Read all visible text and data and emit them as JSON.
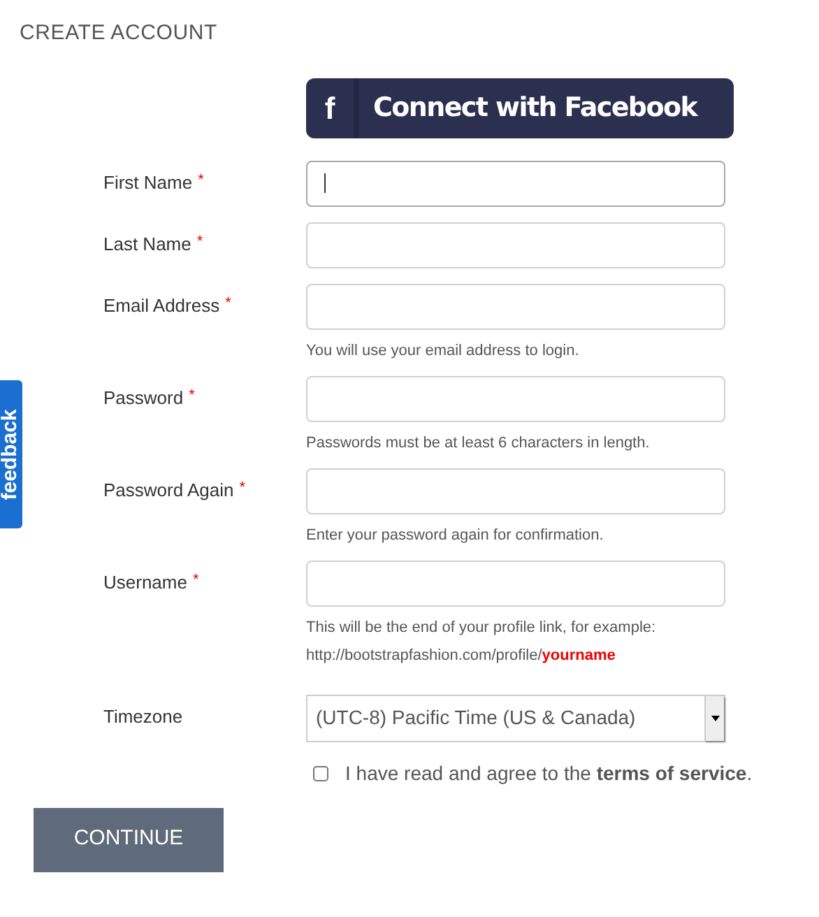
{
  "title": "CREATE ACCOUNT",
  "facebook_button": {
    "icon": "f",
    "label": "Connect with Facebook"
  },
  "feedback_tab": {
    "label": "feedback"
  },
  "fields": [
    {
      "kind": "text",
      "label": "First Name",
      "required": true,
      "focused": true
    },
    {
      "kind": "text",
      "label": "Last Name",
      "required": true,
      "focused": false
    },
    {
      "kind": "text",
      "label": "Email Address",
      "required": true,
      "focused": false,
      "hint": "You will use your email address to login."
    },
    {
      "kind": "text",
      "label": "Password",
      "required": true,
      "focused": false,
      "hint": "Passwords must be at least 6 characters in length."
    },
    {
      "kind": "text",
      "label": "Password Again",
      "required": true,
      "focused": false,
      "hint": "Enter your password again for confirmation."
    },
    {
      "kind": "text",
      "label": "Username",
      "required": true,
      "focused": false,
      "hint": "This will be the end of your profile link, for example:",
      "example": {
        "prefix": "http://bootstrapfashion.com/profile/",
        "highlight": "yourname"
      }
    },
    {
      "kind": "select",
      "label": "Timezone",
      "required": false,
      "value": "(UTC-8) Pacific Time (US & Canada)"
    }
  ],
  "required_mark": "*",
  "terms": {
    "checked": false,
    "text": "I have read and agree to the **terms of service**."
  },
  "continue_button": "CONTINUE"
}
